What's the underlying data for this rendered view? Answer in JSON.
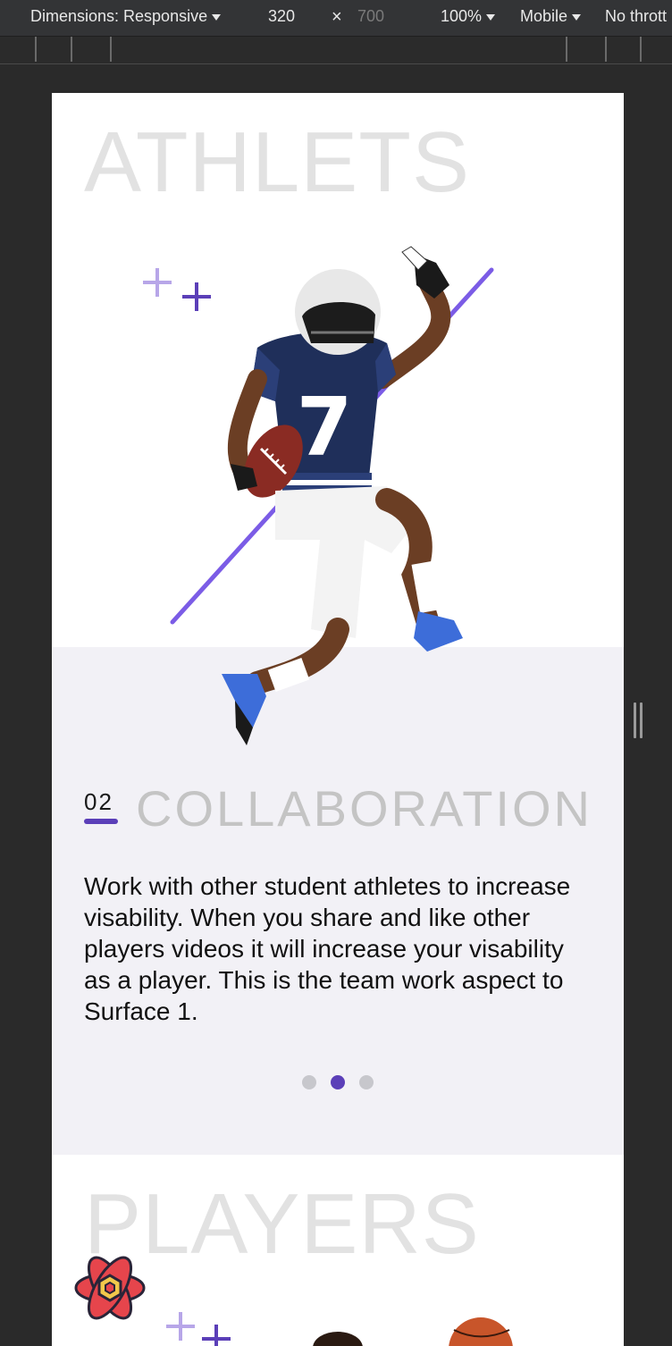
{
  "devtools": {
    "dimensions_label": "Dimensions: Responsive",
    "width": "320",
    "times": "×",
    "height": "700",
    "zoom": "100%",
    "device_type": "Mobile",
    "throttle": "No thrott"
  },
  "page": {
    "heading_top": "ATHLETS",
    "feature_number": "02",
    "feature_title": "COLLABORATION",
    "feature_body": "Work with other student athletes to increase visability. When you share and like other players videos it will increase your visability as a player. This is the team work aspect to Surface 1.",
    "carousel": {
      "count": 3,
      "active_index": 1
    },
    "heading_bottom": "PLAYERS",
    "player_jersey_number": "7"
  },
  "colors": {
    "accent": "#5b3fb8",
    "accent_light": "#b7a6e8",
    "heading_gray": "#e2e2e2",
    "section_bg": "#f2f1f6"
  },
  "icons": [
    "caret-down-icon",
    "close-icon",
    "plus-icon",
    "app-logo-icon",
    "resize-handle-icon"
  ]
}
